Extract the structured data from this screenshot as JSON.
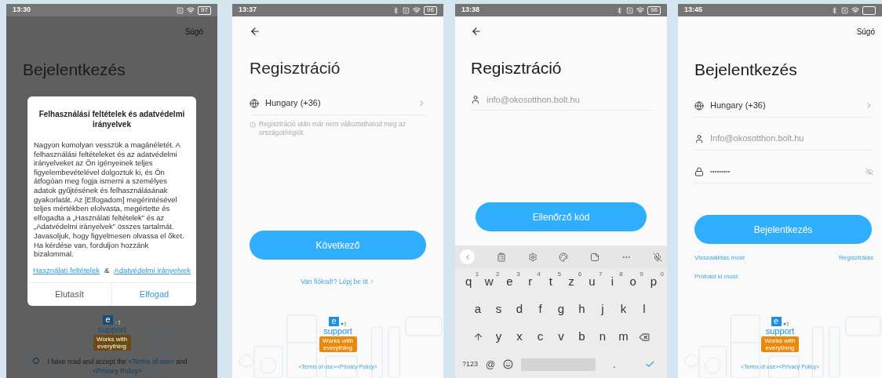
{
  "screens": [
    {
      "kind": "login_dialog",
      "status": {
        "time": "13:30",
        "bluetooth": false,
        "battery": "97"
      },
      "help": "Súgó",
      "title": "Bejelentkezés",
      "dialog": {
        "title": "Felhasználási feltételek és adatvédelmi irányelvek",
        "body": "Nagyon komolyan vesszük a magánéletét. A felhasználási feltételeket és az adatvédelmi irányelveket az Ön igényeinek teljes figyelembevételével dolgoztuk ki, és Ön átfogóan meg fogja ismerni a személyes adatok gyűjtésének és felhasználásának gyakorlatát. Az [Elfogadom] megérintésével teljes mértékben elolvasta, megértette és elfogadta a „Használati feltételek” és az „Adatvédelmi irányelvek” összes tartalmát. Javasoljuk, hogy figyelmesen olvassa el őket. Ha kérdése van, forduljon hozzánk bizalommal.",
        "links": [
          "Használati feltételek",
          "Adatvédelmi irányelvek"
        ],
        "separator": "&",
        "buttons": [
          {
            "label": "Elutasít",
            "kind": "reject"
          },
          {
            "label": "Elfogad",
            "kind": "accept"
          }
        ]
      },
      "logo": {
        "letter": "e",
        "word": "support",
        "badge": "Works with everything"
      },
      "consent": {
        "checked": false,
        "text": "I have read and accept the",
        "terms": "<Terms of use>",
        "joiner": "and",
        "privacy": "<Privacy Policy>"
      }
    },
    {
      "kind": "register_country",
      "status": {
        "time": "13:37",
        "bluetooth": true,
        "battery": "96"
      },
      "title": "Regisztráció",
      "country": "Hungary (+36)",
      "hint": "Regisztráció után már nem változtathatod meg az országot/régiót.",
      "button": "Következő",
      "login_link": "Van fiókod!? Lépj be itt",
      "logo": {
        "letter": "e",
        "word": "support",
        "badge": "Works with everything"
      },
      "legal": "<Terms of use><Privacy Policy>"
    },
    {
      "kind": "register_email",
      "status": {
        "time": "13:38",
        "bluetooth": true,
        "battery": "96"
      },
      "title": "Regisztráció",
      "email_placeholder": "info@okosotthon.bolt.hu",
      "button": "Ellenőrző kód",
      "keyboard": {
        "rows": [
          [
            {
              "key": "q",
              "hint": "1"
            },
            {
              "key": "w",
              "hint": "2"
            },
            {
              "key": "e",
              "hint": "3"
            },
            {
              "key": "r",
              "hint": "4"
            },
            {
              "key": "t",
              "hint": "5"
            },
            {
              "key": "z",
              "hint": "6"
            },
            {
              "key": "u",
              "hint": "7"
            },
            {
              "key": "i",
              "hint": "8"
            },
            {
              "key": "o",
              "hint": "9"
            },
            {
              "key": "p",
              "hint": "0"
            }
          ],
          [
            {
              "key": "a"
            },
            {
              "key": "s"
            },
            {
              "key": "d"
            },
            {
              "key": "f"
            },
            {
              "key": "g"
            },
            {
              "key": "h"
            },
            {
              "key": "j"
            },
            {
              "key": "k"
            },
            {
              "key": "l"
            }
          ],
          [
            {
              "kind": "shift"
            },
            {
              "key": "y"
            },
            {
              "key": "x"
            },
            {
              "key": "c"
            },
            {
              "key": "v"
            },
            {
              "key": "b"
            },
            {
              "key": "n"
            },
            {
              "key": "m"
            },
            {
              "kind": "backspace"
            }
          ]
        ],
        "symbols": "?123",
        "at": "@",
        "period": "."
      }
    },
    {
      "kind": "login",
      "status": {
        "time": "13:45",
        "bluetooth": true
      },
      "help": "Súgó",
      "title": "Bejelentkezés",
      "country": "Hungary (+36)",
      "email": "Info@okosotthon.bolt.hu",
      "password": "•••••••••",
      "button": "Bejelentkezés",
      "reset_link": "Visszaállítás most",
      "register_link": "Regisztrálás",
      "try_link": "Próbáld ki most",
      "logo": {
        "letter": "e",
        "word": "support",
        "badge": "Works with everything"
      },
      "legal": "<Terms of use><Privacy Policy>"
    }
  ]
}
